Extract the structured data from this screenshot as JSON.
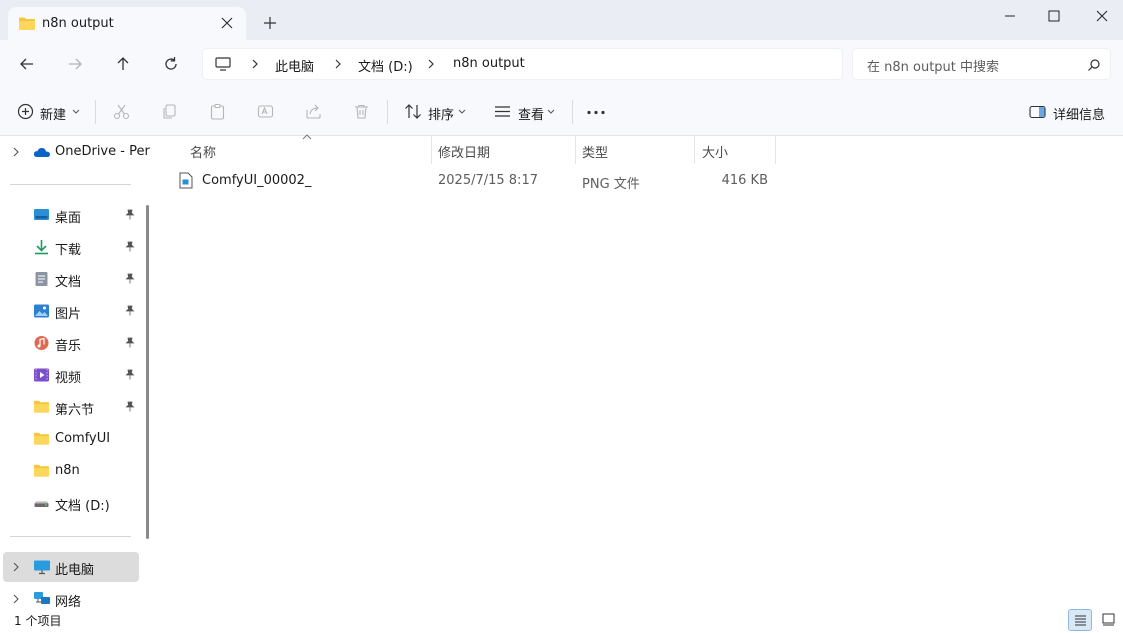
{
  "tab": {
    "title": "n8n output"
  },
  "window_controls": {
    "minimize": "—",
    "maximize": "☐",
    "close": "✕"
  },
  "address": {
    "crumbs": [
      "此电脑",
      "文档 (D:)",
      "n8n output"
    ]
  },
  "search": {
    "placeholder": "在 n8n output 中搜索"
  },
  "toolbar": {
    "new_label": "新建",
    "sort_label": "排序",
    "view_label": "查看",
    "details_label": "详细信息"
  },
  "sidebar": {
    "onedrive": "OneDrive - Per",
    "quick": [
      {
        "label": "桌面",
        "icon": "desktop-icon",
        "pinned": true
      },
      {
        "label": "下载",
        "icon": "download-icon",
        "pinned": true
      },
      {
        "label": "文档",
        "icon": "document-icon",
        "pinned": true
      },
      {
        "label": "图片",
        "icon": "pictures-icon",
        "pinned": true
      },
      {
        "label": "音乐",
        "icon": "music-icon",
        "pinned": true
      },
      {
        "label": "视频",
        "icon": "video-icon",
        "pinned": true
      },
      {
        "label": "第六节",
        "icon": "folder-icon",
        "pinned": true
      },
      {
        "label": "ComfyUI",
        "icon": "folder-icon",
        "pinned": false
      },
      {
        "label": "n8n",
        "icon": "folder-icon",
        "pinned": false
      },
      {
        "label": "文档 (D:)",
        "icon": "drive-icon",
        "pinned": false
      }
    ],
    "this_pc": "此电脑",
    "network": "网络"
  },
  "columns": {
    "name": "名称",
    "modified": "修改日期",
    "type": "类型",
    "size": "大小"
  },
  "files": [
    {
      "name": "ComfyUI_00002_",
      "modified": "2025/7/15 8:17",
      "type": "PNG 文件",
      "size": "416 KB"
    }
  ],
  "status": {
    "count": "1 个项目"
  },
  "colors": {
    "accent": "#0067c0",
    "folder": "#f4c542",
    "selected_bg": "#dcdcdc",
    "chrome_bg": "#f7f9fc"
  }
}
